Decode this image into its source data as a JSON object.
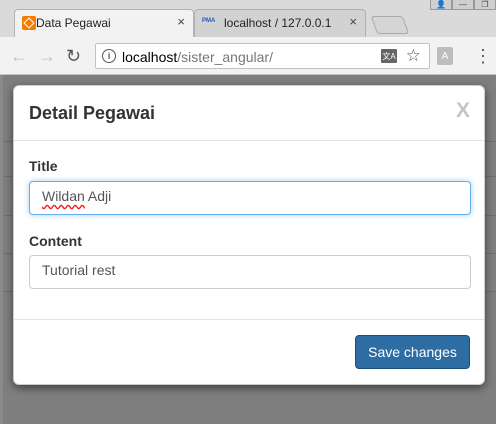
{
  "browser": {
    "tabs": [
      {
        "title": "Data Pegawai",
        "close": "×",
        "favicon": "xampp-icon",
        "active": true
      },
      {
        "title": "localhost / 127.0.0.1 /",
        "close": "×",
        "favicon": "phpmyadmin-icon",
        "favicon_text": "PMA",
        "active": false
      }
    ],
    "window_controls": {
      "user": "👤",
      "minimize": "—",
      "restore": "❐"
    },
    "toolbar": {
      "back": "←",
      "forward": "→",
      "reload": "↻",
      "info": "i",
      "url_host": "localhost",
      "url_path": "/sister_angular/",
      "translate": "文A",
      "star": "☆",
      "extension": "A",
      "menu": "⋮"
    }
  },
  "modal": {
    "title": "Detail Pegawai",
    "close": "X",
    "fields": [
      {
        "label": "Title",
        "value": "Wildan Adji",
        "spell_word": "Wildan",
        "rest": " Adji"
      },
      {
        "label": "Content",
        "value": "Tutorial rest"
      }
    ],
    "save_label": "Save changes"
  },
  "colors": {
    "primary_button": "#2e6da4",
    "focus_ring": "#66afe9"
  }
}
